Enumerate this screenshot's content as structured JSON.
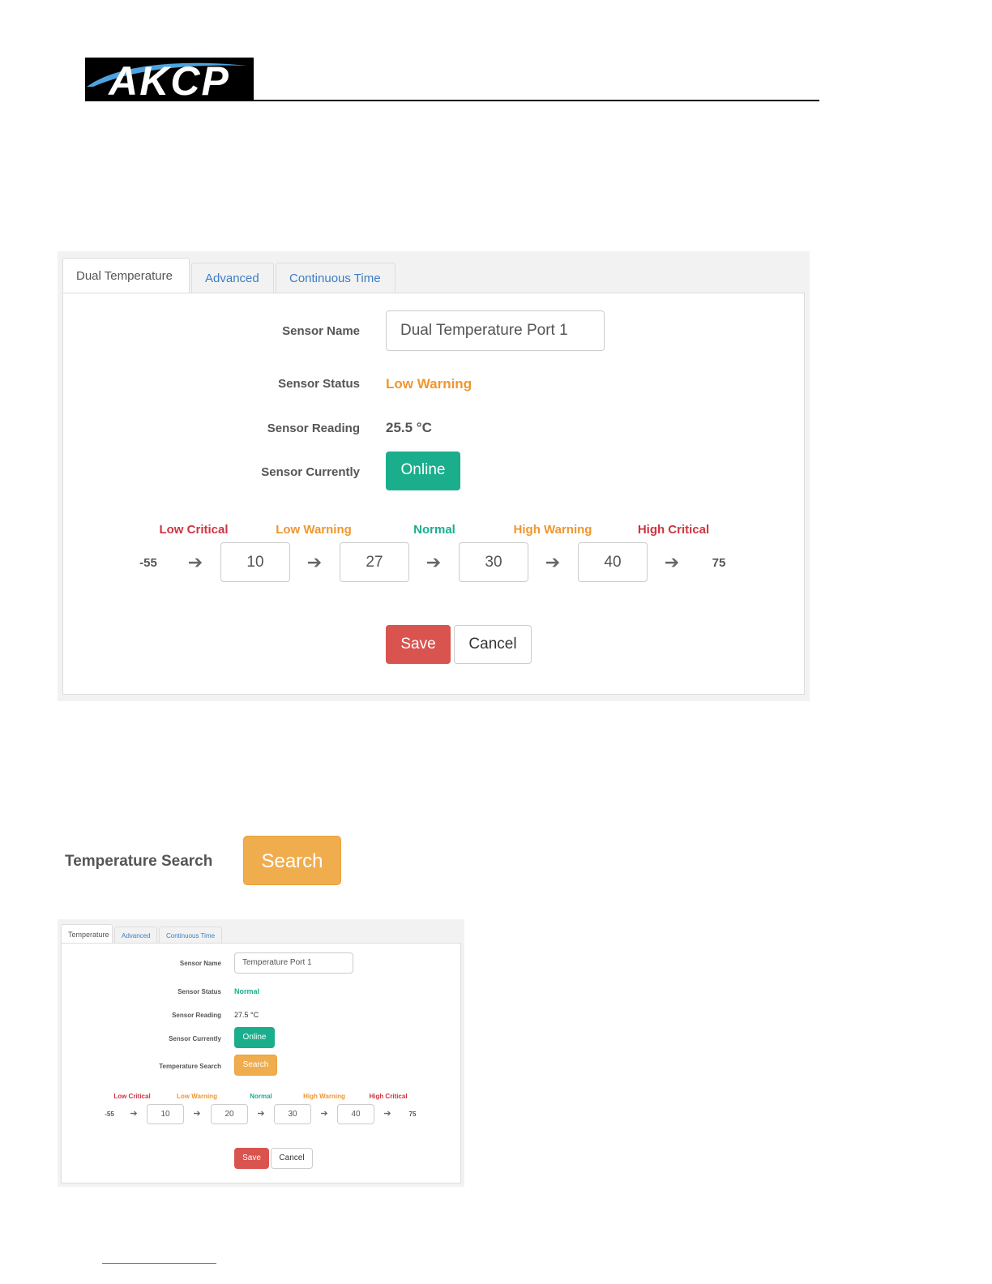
{
  "header": {
    "logo_text": "AKCP"
  },
  "panel1": {
    "tabs": [
      "Dual Temperature",
      "Advanced",
      "Continuous Time"
    ],
    "sensor_name_label": "Sensor Name",
    "sensor_name_value": "Dual Temperature Port 1",
    "sensor_status_label": "Sensor Status",
    "sensor_status_value": "Low Warning",
    "sensor_reading_label": "Sensor Reading",
    "sensor_reading_value": "25.5 °C",
    "sensor_currently_label": "Sensor Currently",
    "sensor_currently_value": "Online",
    "thresholds": {
      "labels": [
        "Low Critical",
        "Low Warning",
        "Normal",
        "High Warning",
        "High Critical"
      ],
      "min": "-55",
      "values": [
        "10",
        "27",
        "30",
        "40"
      ],
      "max": "75",
      "arrow": "➔"
    },
    "save_label": "Save",
    "cancel_label": "Cancel",
    "colors": {
      "critical": "#d0343f",
      "warning": "#f0962e",
      "normal": "#1aae8c",
      "online": "#1aae8c",
      "save": "#d9534f"
    }
  },
  "temperature_search": {
    "label": "Temperature Search",
    "button": "Search"
  },
  "panel2": {
    "tabs": [
      "Temperature",
      "Advanced",
      "Continuous Time"
    ],
    "sensor_name_label": "Sensor Name",
    "sensor_name_value": "Temperature Port 1",
    "sensor_status_label": "Sensor Status",
    "sensor_status_value": "Normal",
    "sensor_reading_label": "Sensor Reading",
    "sensor_reading_value": "27.5 °C",
    "sensor_currently_label": "Sensor Currently",
    "sensor_currently_value": "Online",
    "temperature_search_label": "Temperature Search",
    "temperature_search_button": "Search",
    "thresholds": {
      "labels": [
        "Low Critical",
        "Low Warning",
        "Normal",
        "High Warning",
        "High Critical"
      ],
      "min": "-55",
      "values": [
        "10",
        "20",
        "30",
        "40"
      ],
      "max": "75",
      "arrow": "➔"
    },
    "save_label": "Save",
    "cancel_label": "Cancel"
  }
}
